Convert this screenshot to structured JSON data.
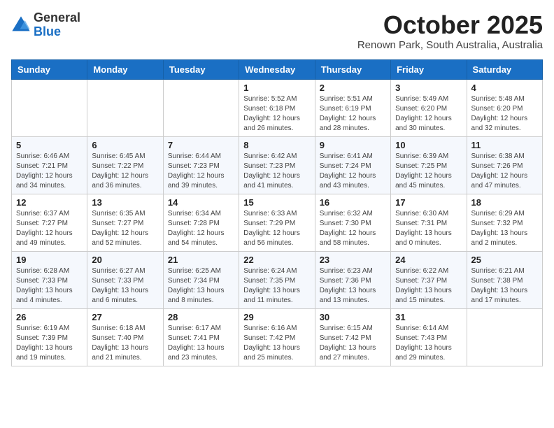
{
  "header": {
    "logo_general": "General",
    "logo_blue": "Blue",
    "month_title": "October 2025",
    "subtitle": "Renown Park, South Australia, Australia"
  },
  "weekdays": [
    "Sunday",
    "Monday",
    "Tuesday",
    "Wednesday",
    "Thursday",
    "Friday",
    "Saturday"
  ],
  "weeks": [
    [
      {
        "day": "",
        "info": ""
      },
      {
        "day": "",
        "info": ""
      },
      {
        "day": "",
        "info": ""
      },
      {
        "day": "1",
        "info": "Sunrise: 5:52 AM\nSunset: 6:18 PM\nDaylight: 12 hours and 26 minutes."
      },
      {
        "day": "2",
        "info": "Sunrise: 5:51 AM\nSunset: 6:19 PM\nDaylight: 12 hours and 28 minutes."
      },
      {
        "day": "3",
        "info": "Sunrise: 5:49 AM\nSunset: 6:20 PM\nDaylight: 12 hours and 30 minutes."
      },
      {
        "day": "4",
        "info": "Sunrise: 5:48 AM\nSunset: 6:20 PM\nDaylight: 12 hours and 32 minutes."
      }
    ],
    [
      {
        "day": "5",
        "info": "Sunrise: 6:46 AM\nSunset: 7:21 PM\nDaylight: 12 hours and 34 minutes."
      },
      {
        "day": "6",
        "info": "Sunrise: 6:45 AM\nSunset: 7:22 PM\nDaylight: 12 hours and 36 minutes."
      },
      {
        "day": "7",
        "info": "Sunrise: 6:44 AM\nSunset: 7:23 PM\nDaylight: 12 hours and 39 minutes."
      },
      {
        "day": "8",
        "info": "Sunrise: 6:42 AM\nSunset: 7:23 PM\nDaylight: 12 hours and 41 minutes."
      },
      {
        "day": "9",
        "info": "Sunrise: 6:41 AM\nSunset: 7:24 PM\nDaylight: 12 hours and 43 minutes."
      },
      {
        "day": "10",
        "info": "Sunrise: 6:39 AM\nSunset: 7:25 PM\nDaylight: 12 hours and 45 minutes."
      },
      {
        "day": "11",
        "info": "Sunrise: 6:38 AM\nSunset: 7:26 PM\nDaylight: 12 hours and 47 minutes."
      }
    ],
    [
      {
        "day": "12",
        "info": "Sunrise: 6:37 AM\nSunset: 7:27 PM\nDaylight: 12 hours and 49 minutes."
      },
      {
        "day": "13",
        "info": "Sunrise: 6:35 AM\nSunset: 7:27 PM\nDaylight: 12 hours and 52 minutes."
      },
      {
        "day": "14",
        "info": "Sunrise: 6:34 AM\nSunset: 7:28 PM\nDaylight: 12 hours and 54 minutes."
      },
      {
        "day": "15",
        "info": "Sunrise: 6:33 AM\nSunset: 7:29 PM\nDaylight: 12 hours and 56 minutes."
      },
      {
        "day": "16",
        "info": "Sunrise: 6:32 AM\nSunset: 7:30 PM\nDaylight: 12 hours and 58 minutes."
      },
      {
        "day": "17",
        "info": "Sunrise: 6:30 AM\nSunset: 7:31 PM\nDaylight: 13 hours and 0 minutes."
      },
      {
        "day": "18",
        "info": "Sunrise: 6:29 AM\nSunset: 7:32 PM\nDaylight: 13 hours and 2 minutes."
      }
    ],
    [
      {
        "day": "19",
        "info": "Sunrise: 6:28 AM\nSunset: 7:33 PM\nDaylight: 13 hours and 4 minutes."
      },
      {
        "day": "20",
        "info": "Sunrise: 6:27 AM\nSunset: 7:33 PM\nDaylight: 13 hours and 6 minutes."
      },
      {
        "day": "21",
        "info": "Sunrise: 6:25 AM\nSunset: 7:34 PM\nDaylight: 13 hours and 8 minutes."
      },
      {
        "day": "22",
        "info": "Sunrise: 6:24 AM\nSunset: 7:35 PM\nDaylight: 13 hours and 11 minutes."
      },
      {
        "day": "23",
        "info": "Sunrise: 6:23 AM\nSunset: 7:36 PM\nDaylight: 13 hours and 13 minutes."
      },
      {
        "day": "24",
        "info": "Sunrise: 6:22 AM\nSunset: 7:37 PM\nDaylight: 13 hours and 15 minutes."
      },
      {
        "day": "25",
        "info": "Sunrise: 6:21 AM\nSunset: 7:38 PM\nDaylight: 13 hours and 17 minutes."
      }
    ],
    [
      {
        "day": "26",
        "info": "Sunrise: 6:19 AM\nSunset: 7:39 PM\nDaylight: 13 hours and 19 minutes."
      },
      {
        "day": "27",
        "info": "Sunrise: 6:18 AM\nSunset: 7:40 PM\nDaylight: 13 hours and 21 minutes."
      },
      {
        "day": "28",
        "info": "Sunrise: 6:17 AM\nSunset: 7:41 PM\nDaylight: 13 hours and 23 minutes."
      },
      {
        "day": "29",
        "info": "Sunrise: 6:16 AM\nSunset: 7:42 PM\nDaylight: 13 hours and 25 minutes."
      },
      {
        "day": "30",
        "info": "Sunrise: 6:15 AM\nSunset: 7:42 PM\nDaylight: 13 hours and 27 minutes."
      },
      {
        "day": "31",
        "info": "Sunrise: 6:14 AM\nSunset: 7:43 PM\nDaylight: 13 hours and 29 minutes."
      },
      {
        "day": "",
        "info": ""
      }
    ]
  ]
}
